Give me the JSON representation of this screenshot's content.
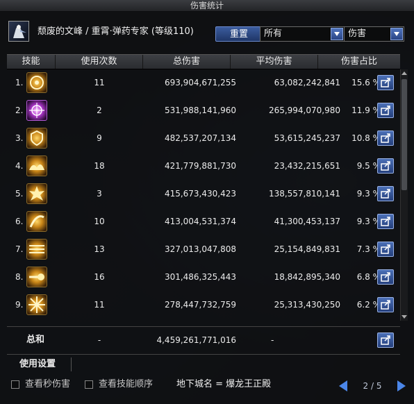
{
  "window": {
    "title": "伤害统计"
  },
  "header": {
    "character": "颓废的文峰 / 重霄·弹药专家 (等级110)",
    "reset_label": "重置",
    "filter_value": "所有",
    "metric_value": "伤害"
  },
  "table": {
    "columns": [
      "技能",
      "使用次数",
      "总伤害",
      "平均伤害",
      "伤害占比"
    ],
    "rows": [
      {
        "rank": "1.",
        "count": "11",
        "total": "693,904,671,255",
        "avg": "63,082,242,841",
        "pct": "15.6 %",
        "icon": "target-emblem-icon"
      },
      {
        "rank": "2.",
        "count": "2",
        "total": "531,988,141,960",
        "avg": "265,994,070,980",
        "pct": "11.9 %",
        "icon": "crosshair-burst-icon"
      },
      {
        "rank": "3.",
        "count": "9",
        "total": "482,537,207,134",
        "avg": "53,615,245,237",
        "pct": "10.8 %",
        "icon": "shield-blast-icon"
      },
      {
        "rank": "4.",
        "count": "18",
        "total": "421,779,881,730",
        "avg": "23,432,215,651",
        "pct": "9.5 %",
        "icon": "fire-wave-icon"
      },
      {
        "rank": "5.",
        "count": "3",
        "total": "415,673,430,423",
        "avg": "138,557,810,141",
        "pct": "9.3 %",
        "icon": "explosion-icon"
      },
      {
        "rank": "6.",
        "count": "10",
        "total": "413,004,531,374",
        "avg": "41,300,453,137",
        "pct": "9.3 %",
        "icon": "slash-arc-icon"
      },
      {
        "rank": "7.",
        "count": "13",
        "total": "327,013,047,808",
        "avg": "25,154,849,831",
        "pct": "7.3 %",
        "icon": "laser-beams-icon"
      },
      {
        "rank": "8.",
        "count": "16",
        "total": "301,486,325,443",
        "avg": "18,842,895,340",
        "pct": "6.8 %",
        "icon": "flare-shot-icon"
      },
      {
        "rank": "9.",
        "count": "11",
        "total": "278,447,732,759",
        "avg": "25,313,430,250",
        "pct": "6.2 %",
        "icon": "starburst-icon"
      }
    ]
  },
  "summary": {
    "label": "总和",
    "count": "-",
    "total": "4,459,261,771,016",
    "avg": "-"
  },
  "settings": {
    "label": "使用设置"
  },
  "footer": {
    "option1": "查看秒伤害",
    "option2": "查看技能顺序",
    "dungeon": "地下城名 = 爆龙王正殿",
    "page": "2 / 5"
  },
  "colors": {
    "accent": "#4b86e8",
    "button": "#3b5c9e",
    "skill_gold": "#c98618"
  }
}
